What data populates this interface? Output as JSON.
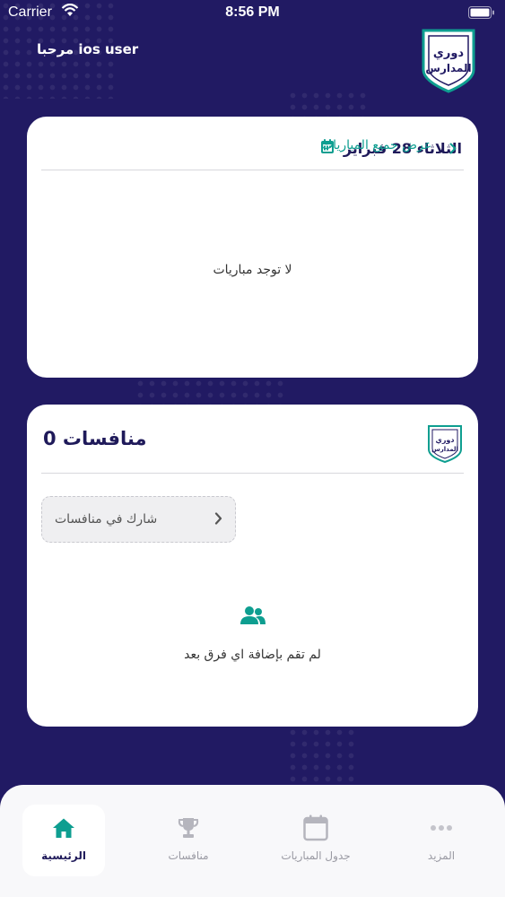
{
  "status_bar": {
    "carrier": "Carrier",
    "time": "8:56 PM"
  },
  "header": {
    "greeting": "مرحبا ios user",
    "logo_line1": "دوري",
    "logo_line2": "المدارس"
  },
  "matches_card": {
    "date": "الثلاثاء 28 فبراير",
    "view_all": "عرض جميع المباريات",
    "empty": "لا توجد مباريات"
  },
  "competitions_card": {
    "title": "منافسات 0",
    "join_label": "شارك في منافسات",
    "empty": "لم تقم بإضافة اي فرق بعد",
    "logo_line1": "دوري",
    "logo_line2": "المدارس"
  },
  "tabbar": {
    "items": [
      {
        "label": "الرئيسية",
        "icon": "home-icon",
        "active": true
      },
      {
        "label": "منافسات",
        "icon": "trophy-icon",
        "active": false
      },
      {
        "label": "جدول المباريات",
        "icon": "calendar-icon",
        "active": false
      },
      {
        "label": "المزيد",
        "icon": "more-icon",
        "active": false
      }
    ]
  },
  "colors": {
    "background": "#211a63",
    "accent": "#0e9e90",
    "title": "#1f1a5a"
  }
}
